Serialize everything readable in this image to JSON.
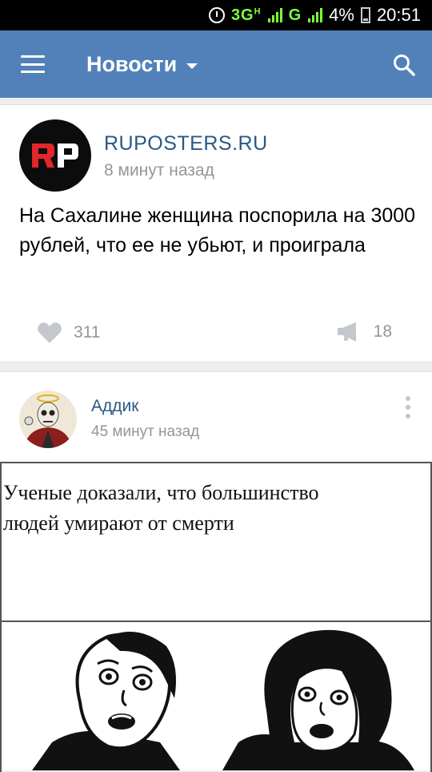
{
  "status_bar": {
    "network": "3G",
    "network_sub": "H",
    "network_alt": "G",
    "battery": "4%",
    "time": "20:51"
  },
  "appbar": {
    "title": "Новости"
  },
  "posts": [
    {
      "author": "RUPOSTERS.RU",
      "time": "8 минут назад",
      "text": "На Сахалине женщина поспорила на 3000 рублей, что ее не убьют, и проиграла",
      "likes": "311",
      "shares": "18"
    },
    {
      "author": "Аддик",
      "time": "45 минут назад",
      "meme_caption_line1": "Ученые доказали, что большинство",
      "meme_caption_line2": "людей умирают от смерти"
    }
  ],
  "icons": {
    "menu": "menu-icon",
    "dropdown": "caret-down-icon",
    "search": "search-icon",
    "like": "heart-icon",
    "share": "megaphone-icon",
    "more": "more-vertical-icon"
  },
  "colors": {
    "appbar": "#5181b8",
    "link": "#2a5885",
    "muted": "#939699",
    "network": "#7cff3a",
    "logo_red": "#e2262a"
  }
}
